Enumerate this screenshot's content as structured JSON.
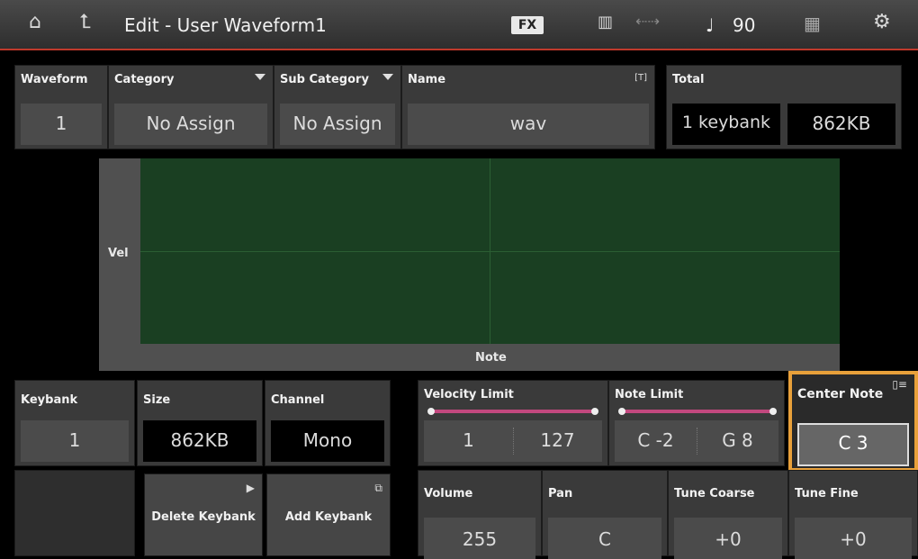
{
  "titlebar": {
    "title": "Edit - User Waveform1",
    "fx": "FX",
    "tempo_symbol": "♩",
    "tempo": "90"
  },
  "top": {
    "waveform": {
      "label": "Waveform",
      "value": "1"
    },
    "category": {
      "label": "Category",
      "value": "No Assign"
    },
    "sub_category": {
      "label": "Sub Category",
      "value": "No Assign"
    },
    "name": {
      "label": "Name",
      "value": "wav",
      "tag": "[T]"
    },
    "total": {
      "label": "Total",
      "keybanks": "1 keybank",
      "size": "862KB"
    }
  },
  "graph": {
    "ylabel": "Vel",
    "xlabel": "Note"
  },
  "row1": {
    "keybank": {
      "label": "Keybank",
      "value": "1"
    },
    "size": {
      "label": "Size",
      "value": "862KB"
    },
    "channel": {
      "label": "Channel",
      "value": "Mono"
    },
    "velocity_limit": {
      "label": "Velocity Limit",
      "low": "1",
      "high": "127"
    },
    "note_limit": {
      "label": "Note Limit",
      "low": "C -2",
      "high": "G 8"
    },
    "center_note": {
      "label": "Center Note",
      "value": "C 3"
    }
  },
  "row2": {
    "delete_keybank": "Delete Keybank",
    "add_keybank": "Add Keybank",
    "volume": {
      "label": "Volume",
      "value": "255"
    },
    "pan": {
      "label": "Pan",
      "value": "C"
    },
    "tune_coarse": {
      "label": "Tune Coarse",
      "value": "+0"
    },
    "tune_fine": {
      "label": "Tune Fine",
      "value": "+0"
    }
  },
  "colors": {
    "accent": "#e8a03a",
    "slider": "#c2487e",
    "plot": "#1a3f22",
    "titlebar_line": "#c0392b"
  }
}
